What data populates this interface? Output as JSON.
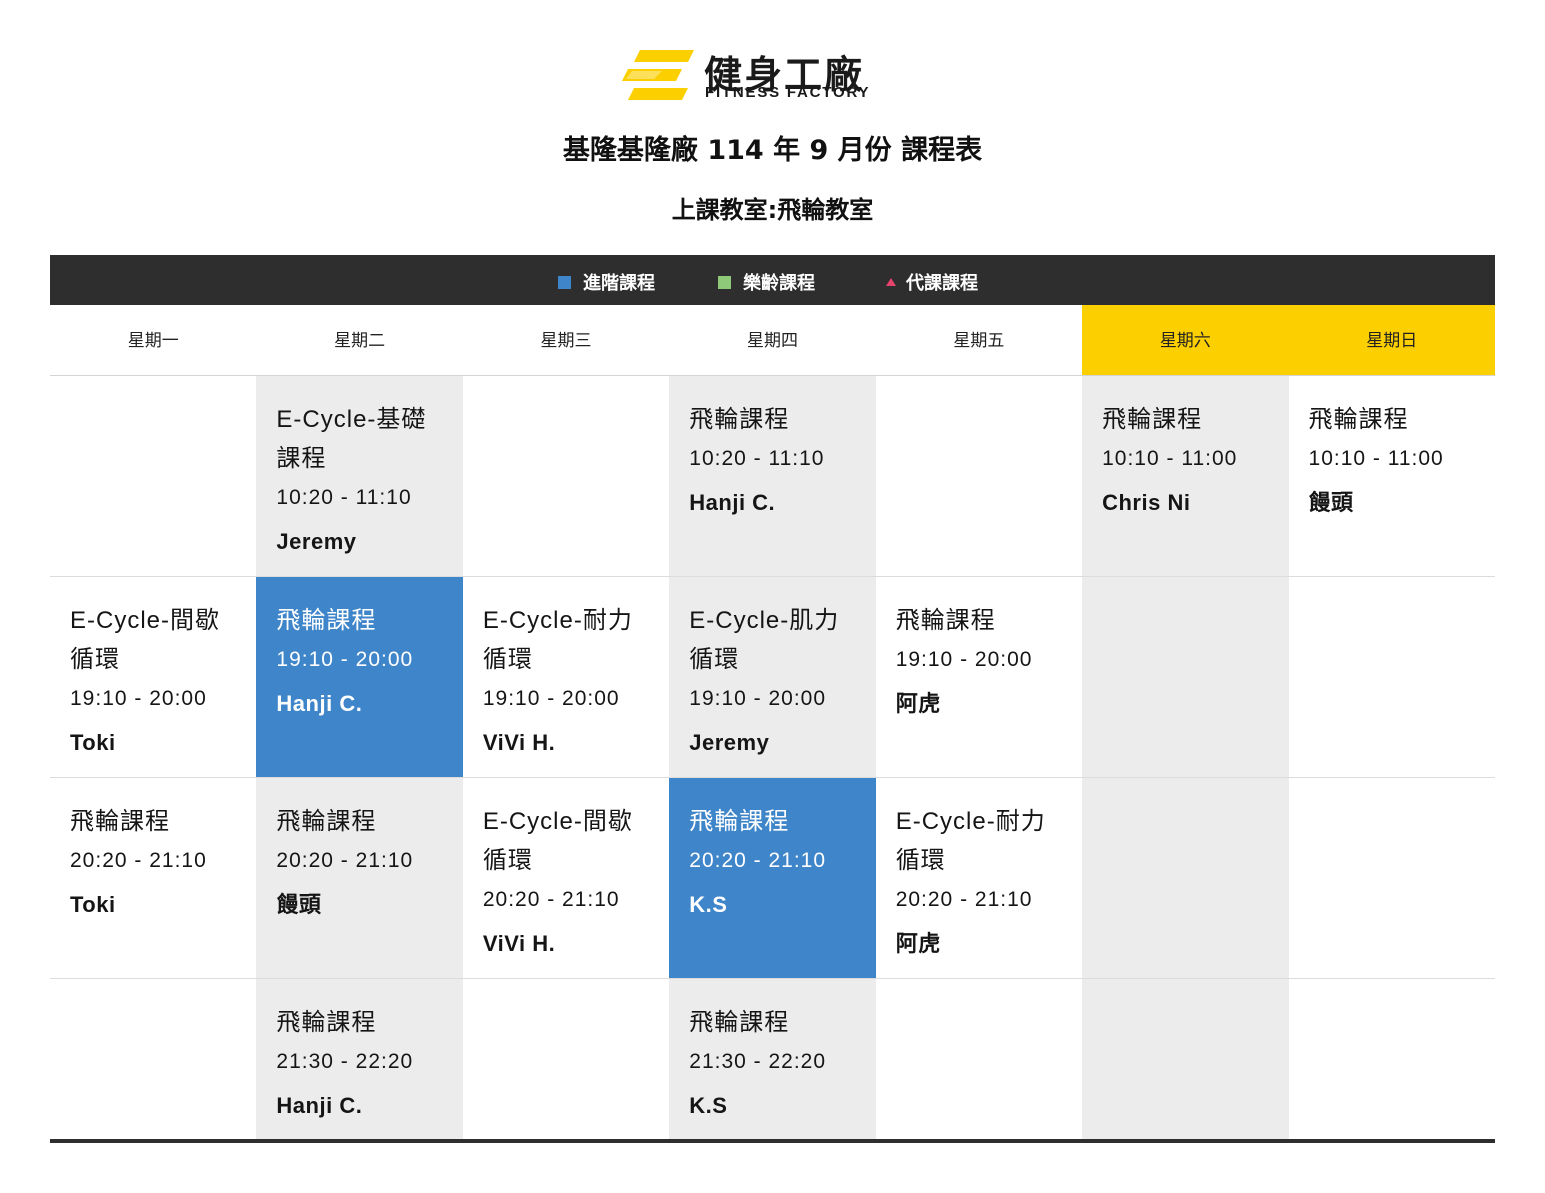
{
  "brand": {
    "name_cn": "健身工廠",
    "name_en": "FITNESS FACTORY",
    "accent_color": "#fccf00",
    "logo_icon": "fitness-factory-logo-icon"
  },
  "title": "基隆基隆廠 114 年 9 月份 課程表",
  "subtitle": "上課教室:飛輪教室",
  "legend": [
    {
      "label": "進階課程",
      "color": "#3f85c9",
      "shape": "square"
    },
    {
      "label": "樂齡課程",
      "color": "#8ec97a",
      "shape": "square"
    },
    {
      "label": "代課課程",
      "color": "#e8436c",
      "shape": "triangle"
    }
  ],
  "days": [
    "星期一",
    "星期二",
    "星期三",
    "星期四",
    "星期五",
    "星期六",
    "星期日"
  ],
  "rows": [
    [
      {
        "style": "empty"
      },
      {
        "style": "gray",
        "name": "E-Cycle-基礎課程",
        "time": "10:20 - 11:10",
        "teacher": "Jeremy"
      },
      {
        "style": "empty"
      },
      {
        "style": "gray",
        "name": "飛輪課程",
        "time": "10:20 - 11:10",
        "teacher": "Hanji C."
      },
      {
        "style": "empty"
      },
      {
        "style": "gray",
        "name": "飛輪課程",
        "time": "10:10 - 11:00",
        "teacher": "Chris Ni"
      },
      {
        "style": "empty",
        "name": "飛輪課程",
        "time": "10:10 - 11:00",
        "teacher": "饅頭"
      }
    ],
    [
      {
        "style": "empty",
        "name": "E-Cycle-間歇循環",
        "time": "19:10 - 20:00",
        "teacher": "Toki"
      },
      {
        "style": "adv",
        "name": "飛輪課程",
        "time": "19:10 - 20:00",
        "teacher": "Hanji C."
      },
      {
        "style": "empty",
        "name": "E-Cycle-耐力循環",
        "time": "19:10 - 20:00",
        "teacher": "ViVi H."
      },
      {
        "style": "gray",
        "name": "E-Cycle-肌力循環",
        "time": "19:10 - 20:00",
        "teacher": "Jeremy"
      },
      {
        "style": "empty",
        "name": "飛輪課程",
        "time": "19:10 - 20:00",
        "teacher": "阿虎"
      },
      {
        "style": "gray"
      },
      {
        "style": "empty"
      }
    ],
    [
      {
        "style": "empty",
        "name": "飛輪課程",
        "time": "20:20 - 21:10",
        "teacher": "Toki"
      },
      {
        "style": "gray",
        "name": "飛輪課程",
        "time": "20:20 - 21:10",
        "teacher": "饅頭"
      },
      {
        "style": "empty",
        "name": "E-Cycle-間歇循環",
        "time": "20:20 - 21:10",
        "teacher": "ViVi H."
      },
      {
        "style": "adv",
        "name": "飛輪課程",
        "time": "20:20 - 21:10",
        "teacher": "K.S"
      },
      {
        "style": "empty",
        "name": "E-Cycle-耐力循環",
        "time": "20:20 - 21:10",
        "teacher": "阿虎"
      },
      {
        "style": "gray"
      },
      {
        "style": "empty"
      }
    ],
    [
      {
        "style": "empty"
      },
      {
        "style": "gray",
        "name": "飛輪課程",
        "time": "21:30 - 22:20",
        "teacher": "Hanji C."
      },
      {
        "style": "empty"
      },
      {
        "style": "gray",
        "name": "飛輪課程",
        "time": "21:30 - 22:20",
        "teacher": "K.S"
      },
      {
        "style": "empty"
      },
      {
        "style": "gray"
      },
      {
        "style": "empty"
      }
    ]
  ]
}
